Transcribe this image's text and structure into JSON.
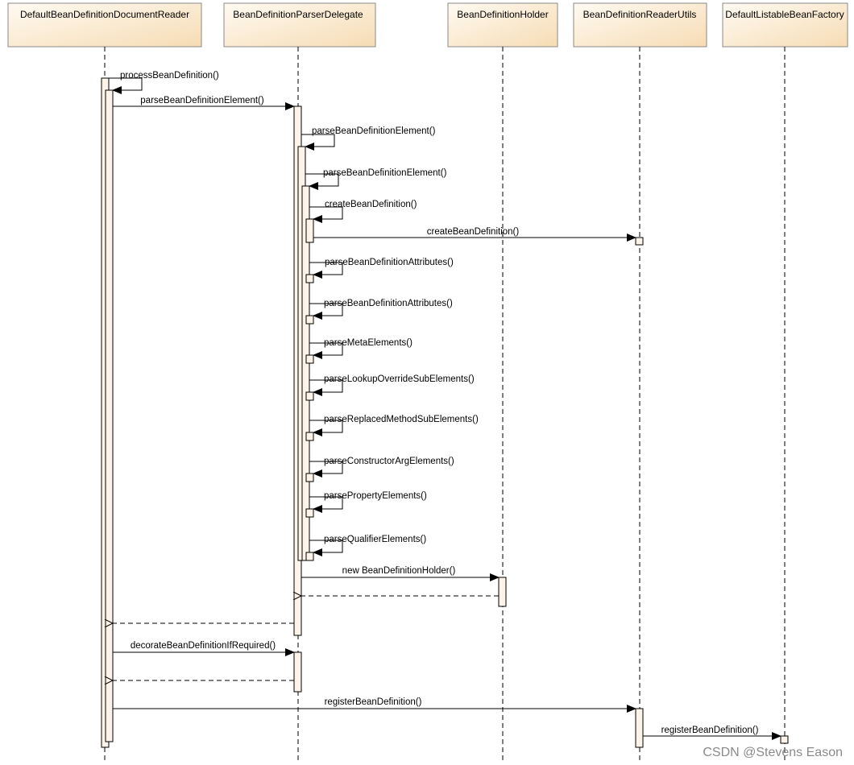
{
  "participants": [
    {
      "name": "DefaultBeanDefinitionDocumentReader"
    },
    {
      "name": "BeanDefinitionParserDelegate"
    },
    {
      "name": "BeanDefinitionHolder"
    },
    {
      "name": "BeanDefinitionReaderUtils"
    },
    {
      "name": "DefaultListableBeanFactory"
    }
  ],
  "messages": [
    {
      "label": "processBeanDefinition()",
      "from": 0,
      "to": 0,
      "kind": "self"
    },
    {
      "label": "parseBeanDefinitionElement()",
      "from": 0,
      "to": 1,
      "kind": "call"
    },
    {
      "label": "parseBeanDefinitionElement()",
      "from": 1,
      "to": 1,
      "kind": "self"
    },
    {
      "label": "parseBeanDefinitionElement()",
      "from": 1,
      "to": 1,
      "kind": "self"
    },
    {
      "label": "createBeanDefinition()",
      "from": 1,
      "to": 1,
      "kind": "self"
    },
    {
      "label": "createBeanDefinition()",
      "from": 1,
      "to": 3,
      "kind": "call"
    },
    {
      "label": "parseBeanDefinitionAttributes()",
      "from": 1,
      "to": 1,
      "kind": "self"
    },
    {
      "label": "parseBeanDefinitionAttributes()",
      "from": 1,
      "to": 1,
      "kind": "self"
    },
    {
      "label": "parseMetaElements()",
      "from": 1,
      "to": 1,
      "kind": "self"
    },
    {
      "label": "parseLookupOverrideSubElements()",
      "from": 1,
      "to": 1,
      "kind": "self"
    },
    {
      "label": "parseReplacedMethodSubElements()",
      "from": 1,
      "to": 1,
      "kind": "self"
    },
    {
      "label": "parseConstructorArgElements()",
      "from": 1,
      "to": 1,
      "kind": "self"
    },
    {
      "label": "parsePropertyElements()",
      "from": 1,
      "to": 1,
      "kind": "self"
    },
    {
      "label": "parseQualifierElements()",
      "from": 1,
      "to": 1,
      "kind": "self"
    },
    {
      "label": "new BeanDefinitionHolder()",
      "from": 1,
      "to": 2,
      "kind": "call"
    },
    {
      "label": "",
      "from": 2,
      "to": 1,
      "kind": "return"
    },
    {
      "label": "",
      "from": 1,
      "to": 0,
      "kind": "return"
    },
    {
      "label": "decorateBeanDefinitionIfRequired()",
      "from": 0,
      "to": 1,
      "kind": "call"
    },
    {
      "label": "",
      "from": 1,
      "to": 0,
      "kind": "return"
    },
    {
      "label": "registerBeanDefinition()",
      "from": 0,
      "to": 3,
      "kind": "call"
    },
    {
      "label": "registerBeanDefinition()",
      "from": 3,
      "to": 4,
      "kind": "call"
    }
  ],
  "watermark": "CSDN @Stevens Eason",
  "colors": {
    "header_fill_top": "#fffaf2",
    "header_fill_bottom": "#f6dcb4",
    "activation_fill": "#fdf3e8",
    "line": "#000000"
  }
}
